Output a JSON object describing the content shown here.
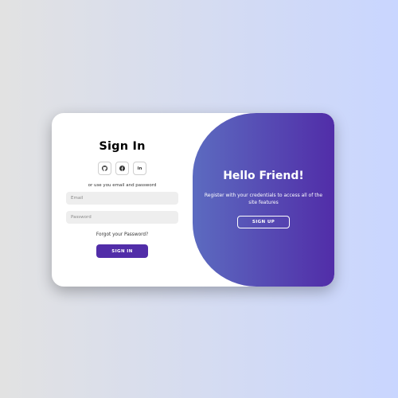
{
  "colors": {
    "accent": "#512da8",
    "panel_gradient_start": "#5c6bc0",
    "panel_gradient_end": "#512da8",
    "background_start": "#e2e2e2",
    "background_end": "#c9d6ff"
  },
  "signin": {
    "title": "Sign In",
    "social": [
      {
        "icon": "github-icon"
      },
      {
        "icon": "facebook-icon"
      },
      {
        "icon": "linkedin-icon",
        "glyph": "in"
      }
    ],
    "alt_text": "or use you email and password",
    "email_placeholder": "Email",
    "password_placeholder": "Password",
    "forgot_label": "Forgot your Password?",
    "button_label": "SIGN IN"
  },
  "panel": {
    "title": "Hello Friend!",
    "text": "Register with your credentials to access all of the site features",
    "button_label": "SIGN UP"
  }
}
